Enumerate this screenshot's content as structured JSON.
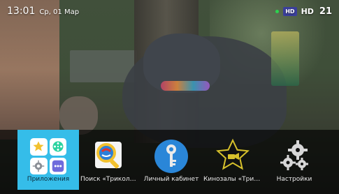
{
  "status": {
    "time": "13:01",
    "date": "Ср, 01 Мар",
    "hd_badge": "HD",
    "hd_label": "HD",
    "channel_number": "21"
  },
  "menu": {
    "selected_index": 0,
    "items": [
      {
        "label": "Приложения",
        "icon": "apps-grid-icon"
      },
      {
        "label": "Поиск «Триколор ...",
        "icon": "search-magnifier-icon"
      },
      {
        "label": "Личный кабинет",
        "icon": "key-icon"
      },
      {
        "label": "Кинозалы «Трико...",
        "icon": "star-camera-icon"
      },
      {
        "label": "Настройки",
        "icon": "gears-icon"
      }
    ]
  },
  "colors": {
    "accent": "#35bde9",
    "status_dot": "#2bd34f",
    "hd_badge_bg": "#3b3f9b"
  }
}
